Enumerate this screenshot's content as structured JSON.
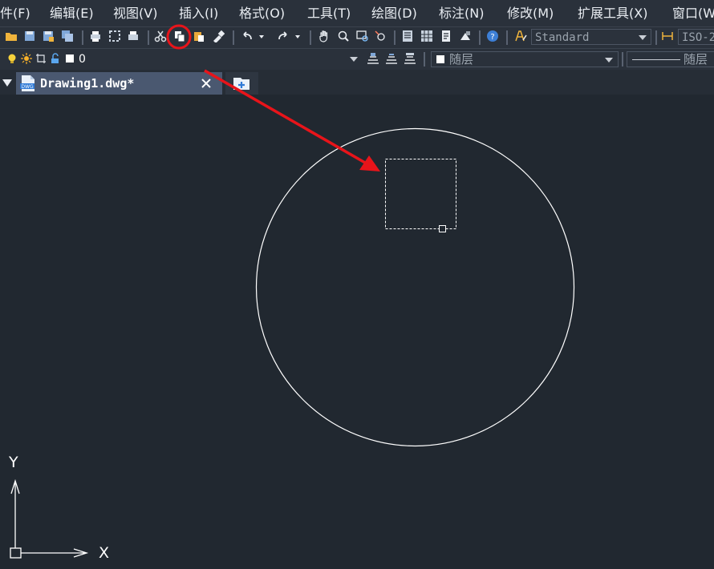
{
  "menu": {
    "items": [
      "件(F)",
      "编辑(E)",
      "视图(V)",
      "插入(I)",
      "格式(O)",
      "工具(T)",
      "绘图(D)",
      "标注(N)",
      "修改(M)",
      "扩展工具(X)",
      "窗口(W"
    ]
  },
  "toolbar": {
    "text_style_value": "Standard",
    "dim_style_value": "ISO-2"
  },
  "layer_bar": {
    "current_layer": "0",
    "color_value": "随层",
    "linetype_value": "随层"
  },
  "tabs": {
    "active_title": "Drawing1.dwg*"
  },
  "ucs": {
    "y_label": "Y",
    "x_label": "X"
  },
  "colors": {
    "background": "#212830",
    "annotation_red": "#e8141a",
    "drawing_white": "#ffffff"
  }
}
